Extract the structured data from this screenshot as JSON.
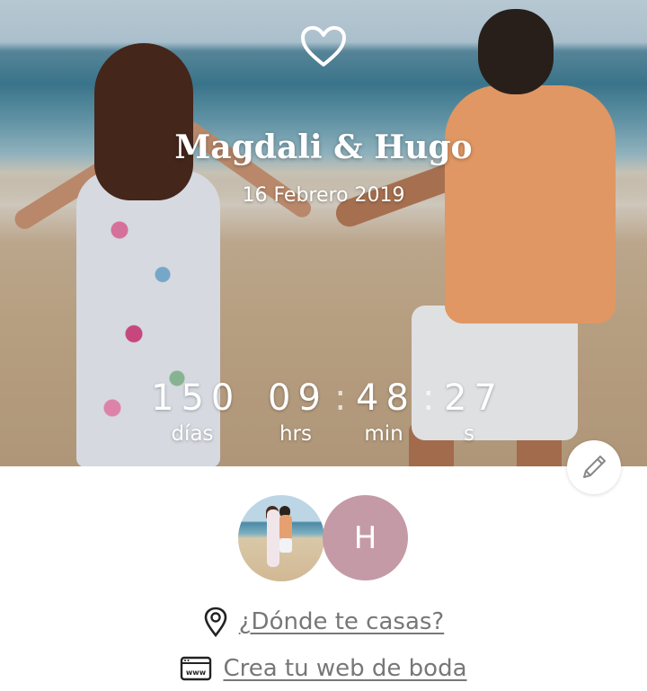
{
  "hero": {
    "couple_name": "Magdali & Hugo",
    "date": "16 Febrero 2019",
    "countdown": {
      "days": "150",
      "hours": "09",
      "minutes": "48",
      "seconds": "27",
      "separator": ":",
      "days_label": "días",
      "hours_label": "hrs",
      "minutes_label": "min",
      "seconds_label": "s"
    },
    "icons": {
      "top": "heart-icon",
      "edit": "pencil-icon"
    }
  },
  "avatars": {
    "second_initial": "H",
    "second_color": "#c49aa6"
  },
  "links": {
    "where_label": "¿Dónde te casas?",
    "where_icon": "location-pin-icon",
    "web_label": "Crea tu web de boda",
    "web_icon": "www-browser-icon"
  },
  "colors": {
    "link_text": "#777777"
  }
}
